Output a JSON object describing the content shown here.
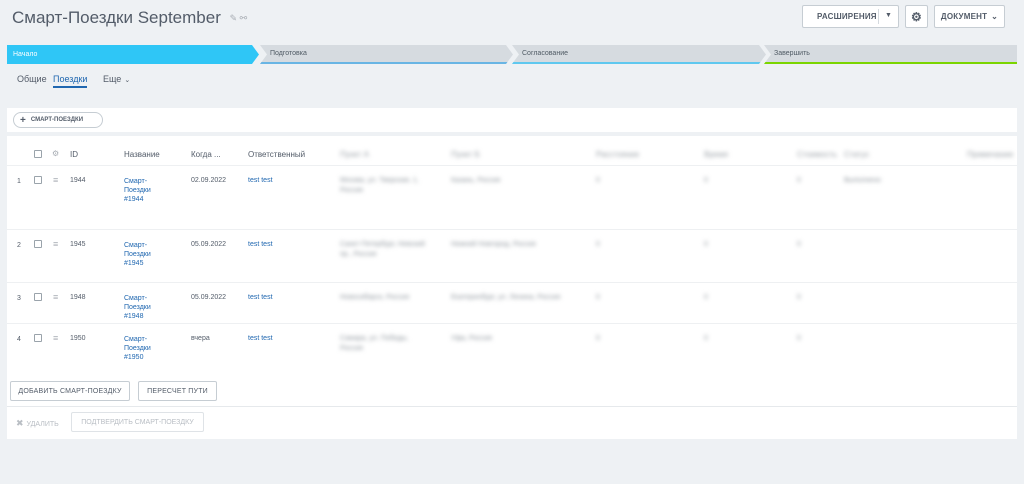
{
  "header": {
    "title": "Смарт-Поездки September",
    "extensions_label": "РАСШИРЕНИЯ",
    "document_label": "ДОКУМЕНТ"
  },
  "stages": [
    {
      "label": "Начало",
      "color": "#2fc6f6"
    },
    {
      "label": "Подготовка",
      "color": "#69b5e4"
    },
    {
      "label": "Согласование",
      "color": "#5fc8ef"
    },
    {
      "label": "Завершить",
      "color": "#7bd500"
    }
  ],
  "tabs": [
    {
      "label": "Общие"
    },
    {
      "label": "Поездки",
      "active": true
    },
    {
      "label": "Еще"
    }
  ],
  "toolbar": {
    "add_label": "СМАРТ-ПОЕЗДКИ"
  },
  "table": {
    "columns": [
      "ID",
      "Название",
      "Когда ...",
      "Ответственный",
      "Пункт А",
      "Пункт Б",
      "Расстояние",
      "Время",
      "Стоимость",
      "Статус",
      "Примечание"
    ],
    "rows": [
      {
        "num": "1",
        "id": "1944",
        "name": "Смарт-Поездки #1944",
        "when": "02.09.2022",
        "resp": "test test",
        "a": "Москва, ул. Тверская, 1, Россия",
        "b": "Казань, Россия",
        "c": "0",
        "d": "0",
        "e": "0",
        "f": "Выполнено"
      },
      {
        "num": "2",
        "id": "1945",
        "name": "Смарт-Поездки #1945",
        "when": "05.09.2022",
        "resp": "test test",
        "a": "Санкт-Петербург, Невский пр., Россия",
        "b": "Нижний Новгород, Россия",
        "c": "0",
        "d": "0",
        "e": "0",
        "f": ""
      },
      {
        "num": "3",
        "id": "1948",
        "name": "Смарт-Поездки #1948",
        "when": "05.09.2022",
        "resp": "test test",
        "a": "Новосибирск, Россия",
        "b": "Екатеринбург, ул. Ленина, Россия",
        "c": "0",
        "d": "0",
        "e": "0",
        "f": ""
      },
      {
        "num": "4",
        "id": "1950",
        "name": "Смарт-Поездки #1950",
        "when": "вчера",
        "resp": "test test",
        "a": "Самара, ул. Победы, Россия",
        "b": "Уфа, Россия",
        "c": "0",
        "d": "0",
        "e": "0",
        "f": ""
      }
    ]
  },
  "actions": {
    "add_bottom": "ДОБАВИТЬ СМАРТ-ПОЕЗДКУ",
    "recalc": "ПЕРЕСЧЕТ ПУТИ",
    "delete": "УДАЛИТЬ",
    "confirm": "ПОДТВЕРДИТЬ СМАРТ-ПОЕЗДКУ"
  }
}
